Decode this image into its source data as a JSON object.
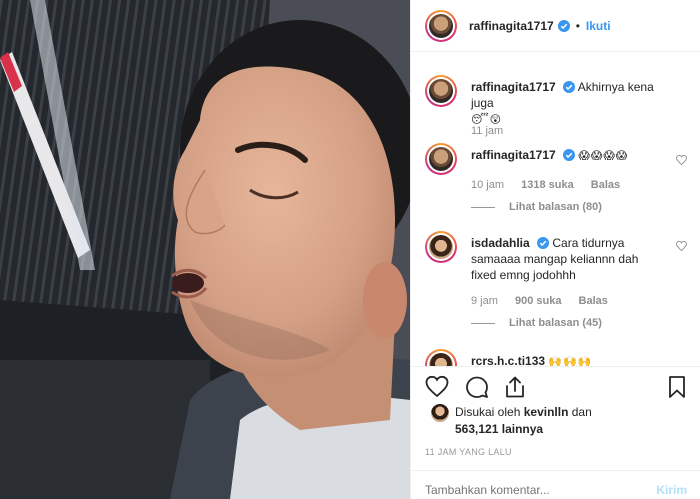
{
  "header": {
    "username": "raffinagita1717",
    "separator": "•",
    "follow_label": "Ikuti"
  },
  "comments": [
    {
      "username": "raffinagita1717",
      "text": "Akhirnya kena juga",
      "emoji": "😴😲",
      "time": "11 jam",
      "verified": true
    },
    {
      "username": "raffinagita1717",
      "text": "",
      "emoji": "😱😱😱😱",
      "time": "10 jam",
      "likes": "1318 suka",
      "reply": "Balas",
      "view_replies": "Lihat balasan (80)",
      "verified": true
    },
    {
      "username": "isdadahlia",
      "text": "Cara tidurnya samaaaa mangap keliannn dah fixed emng jodohhh",
      "time": "9 jam",
      "likes": "900 suka",
      "reply": "Balas",
      "view_replies": "Lihat balasan (45)",
      "verified": true
    },
    {
      "username": "rcrs.h.c.ti133",
      "text": "",
      "emoji": "🙌🙌🙌",
      "partial": true
    }
  ],
  "likes": {
    "line1_prefix": "Disukai oleh",
    "line1_user": "kevinlln",
    "line1_suffix": "dan",
    "count": "563,121",
    "count_suffix": "lainnya"
  },
  "post_time": "11 JAM YANG LALU",
  "add_comment": {
    "placeholder": "Tambahkan komentar...",
    "send_label": "Kirim"
  },
  "colors": {
    "accent": "#3897f0",
    "verified": "#3897f0",
    "muted": "#8e8e8e",
    "send_disabled": "#b2dffc"
  },
  "icons": {
    "like": "heart-icon",
    "comment": "comment-icon",
    "share": "share-icon",
    "save": "bookmark-icon",
    "verified": "verified-badge-icon"
  }
}
